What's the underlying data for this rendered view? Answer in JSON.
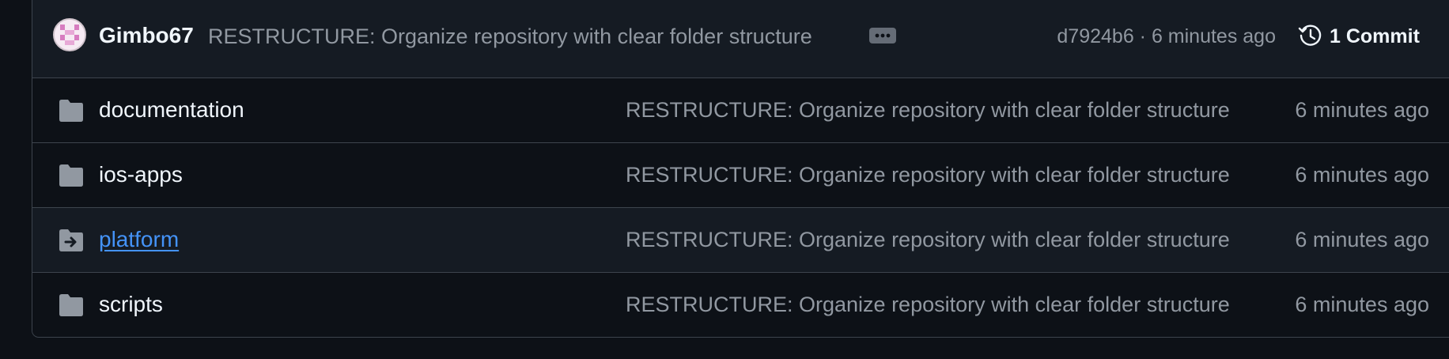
{
  "latest_commit": {
    "author": "Gimbo67",
    "message": "RESTRUCTURE: Organize repository with clear folder structure",
    "sha_time": "d7924b6 · 6 minutes ago",
    "commits_label": "1 Commit"
  },
  "files": [
    {
      "name": "documentation",
      "icon": "folder-icon",
      "message": "RESTRUCTURE: Organize repository with clear folder structure",
      "time": "6 minutes ago"
    },
    {
      "name": "ios-apps",
      "icon": "folder-icon",
      "message": "RESTRUCTURE: Organize repository with clear folder structure",
      "time": "6 minutes ago"
    },
    {
      "name": "platform",
      "icon": "submodule-folder-icon",
      "message": "RESTRUCTURE: Organize repository with clear folder structure",
      "time": "6 minutes ago"
    },
    {
      "name": "scripts",
      "icon": "folder-icon",
      "message": "RESTRUCTURE: Organize repository with clear folder structure",
      "time": "6 minutes ago"
    }
  ],
  "colors": {
    "background": "#0d1117",
    "header_background": "#151b23",
    "border": "#3d444d",
    "link": "#4493f8",
    "muted_text": "#9198a1",
    "primary_text": "#f0f6fc"
  }
}
